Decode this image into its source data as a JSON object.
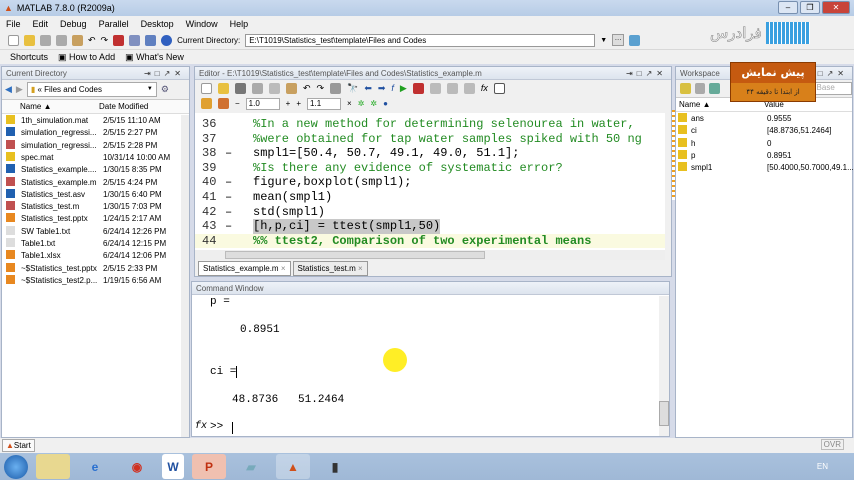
{
  "window": {
    "title": "MATLAB 7.8.0 (R2009a)"
  },
  "menu": [
    "File",
    "Edit",
    "Debug",
    "Parallel",
    "Desktop",
    "Window",
    "Help"
  ],
  "toolbar": {
    "current_dir_label": "Current Directory:",
    "current_dir_value": "E:\\T1019\\Statistics_test\\template\\Files and Codes"
  },
  "shortcuts": {
    "label": "Shortcuts",
    "items": [
      "How to Add",
      "What's New"
    ]
  },
  "logo": {
    "text": "فرادرس"
  },
  "current_directory": {
    "title": "Current Directory",
    "path": "« Files and Codes",
    "col_name": "Name ▲",
    "col_date": "Date Modified",
    "files": [
      {
        "name": "1th_simulation.mat",
        "date": "2/5/15 11:10 AM",
        "type": "mat"
      },
      {
        "name": "simulation_regressi...",
        "date": "2/5/15 2:27 PM",
        "type": "asv"
      },
      {
        "name": "simulation_regressi...",
        "date": "2/5/15 2:28 PM",
        "type": "m"
      },
      {
        "name": "spec.mat",
        "date": "10/31/14 10:00 AM",
        "type": "mat"
      },
      {
        "name": "Statistics_example....",
        "date": "1/30/15 8:35 PM",
        "type": "asv"
      },
      {
        "name": "Statistics_example.m",
        "date": "2/5/15 4:24 PM",
        "type": "m"
      },
      {
        "name": "Statistics_test.asv",
        "date": "1/30/15 6:40 PM",
        "type": "asv"
      },
      {
        "name": "Statistics_test.m",
        "date": "1/30/15 7:03 PM",
        "type": "m"
      },
      {
        "name": "Statistics_test.pptx",
        "date": "1/24/15 2:17 AM",
        "type": "pptx"
      },
      {
        "name": "SW Table1.txt",
        "date": "6/24/14 12:26 PM",
        "type": "txt"
      },
      {
        "name": "Table1.txt",
        "date": "6/24/14 12:15 PM",
        "type": "txt"
      },
      {
        "name": "Table1.xlsx",
        "date": "6/24/14 12:06 PM",
        "type": "pptx"
      },
      {
        "name": "~$Statistics_test.pptx",
        "date": "2/5/15 2:33 PM",
        "type": "pptx"
      },
      {
        "name": "~$Statistics_test2.p...",
        "date": "1/19/15 6:56 AM",
        "type": "pptx"
      }
    ]
  },
  "editor": {
    "title": "Editor - E:\\T1019\\Statistics_test\\template\\Files and Codes\\Statistics_example.m",
    "cell_minus": "−",
    "cell_val1": "1.0",
    "cell_plus": "+",
    "cell_val2": "1.1",
    "cell_x": "×",
    "lines": [
      {
        "num": "36",
        "dash": "",
        "text": "%In a new method for determining selenourea in water,",
        "comment": true
      },
      {
        "num": "37",
        "dash": "",
        "text": "%were obtained for tap water samples spiked with 50 ng",
        "comment": true
      },
      {
        "num": "38",
        "dash": "–",
        "text": "smpl1=[50.4, 50.7, 49.1, 49.0, 51.1];",
        "comment": false
      },
      {
        "num": "39",
        "dash": "",
        "text": "%Is there any evidence of systematic error?",
        "comment": true
      },
      {
        "num": "40",
        "dash": "–",
        "text": "figure,boxplot(smpl1);",
        "comment": false
      },
      {
        "num": "41",
        "dash": "–",
        "text": "mean(smpl1)",
        "comment": false
      },
      {
        "num": "42",
        "dash": "–",
        "text": "std(smpl1)",
        "comment": false
      },
      {
        "num": "43",
        "dash": "–",
        "text": "[h,p,ci] = ttest(smpl1,50)",
        "comment": false,
        "selected": true
      },
      {
        "num": "44",
        "dash": "",
        "text": "%% ttest2, Comparison of two experimental means",
        "comment": true,
        "cell": true
      }
    ],
    "tabs": [
      "Statistics_example.m",
      "Statistics_test.m"
    ]
  },
  "command_window": {
    "title": "Command Window",
    "lines": [
      "p =",
      "0.8951",
      "ci =",
      "48.8736   51.2464"
    ],
    "prompt": ">>",
    "fx": "fx"
  },
  "workspace": {
    "title": "Workspace",
    "col_name": "Name ▲",
    "col_value": "Value",
    "stack": "Base",
    "vars": [
      {
        "name": "ans",
        "value": "0.9555"
      },
      {
        "name": "ci",
        "value": "[48.8736,51.2464]"
      },
      {
        "name": "h",
        "value": "0"
      },
      {
        "name": "p",
        "value": "0.8951"
      },
      {
        "name": "smpl1",
        "value": "[50.4000,50.7000,49.1..."
      }
    ]
  },
  "banner": {
    "title": "پیش نمایش",
    "subtitle": "از ابتدا تا دقیقه ۴۴"
  },
  "status": {
    "start": "Start",
    "ovr": "OVR"
  },
  "taskbar": {
    "lang": "EN"
  }
}
